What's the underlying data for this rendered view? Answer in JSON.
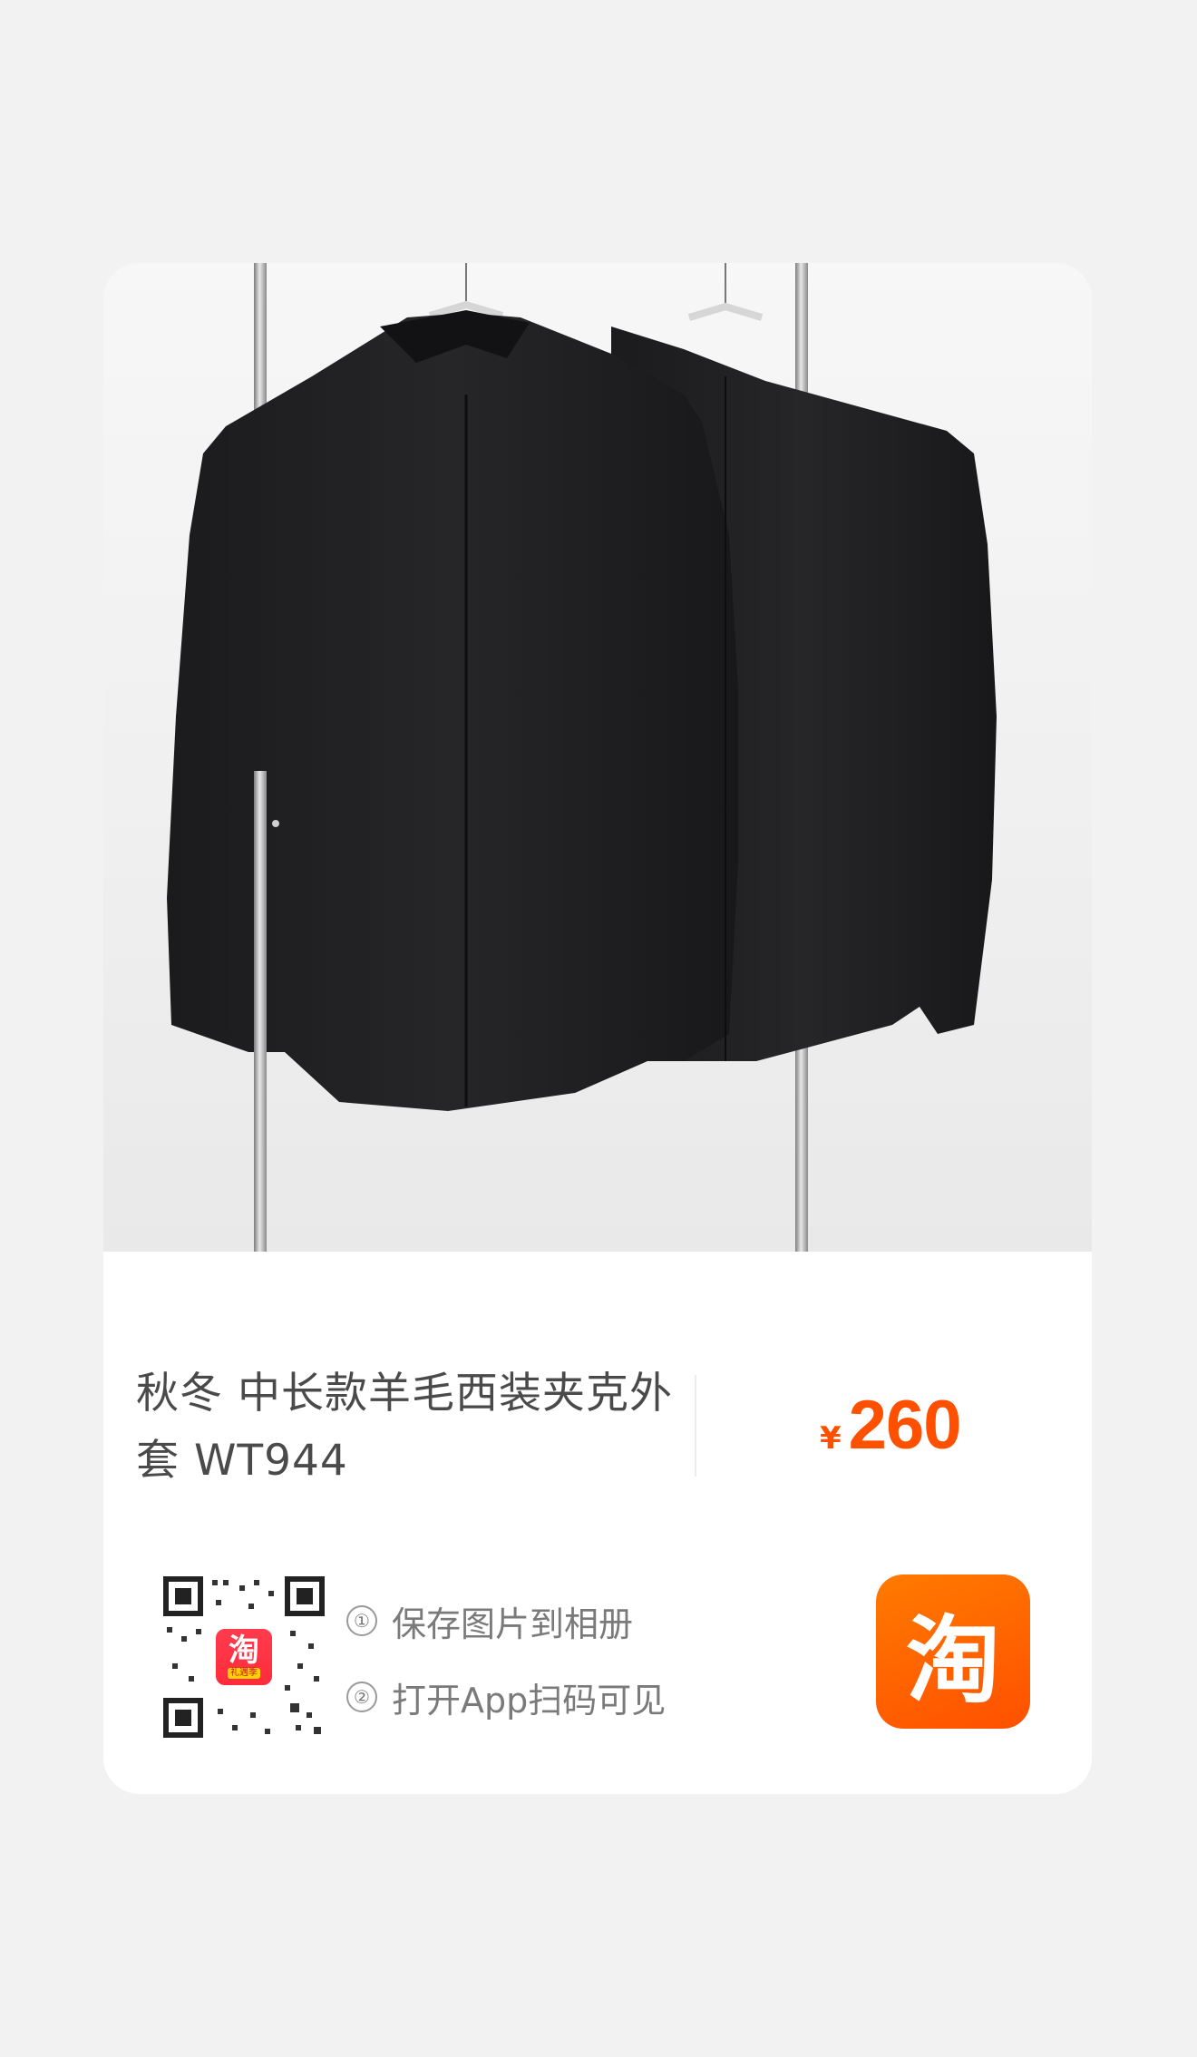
{
  "product": {
    "title": "秋冬 中长款羊毛西装夹克外套 WT944",
    "price_currency": "¥",
    "price_value": "260"
  },
  "share": {
    "step1_num": "①",
    "step1_label": "保存图片到相册",
    "step2_num": "②",
    "step2_label": "打开App扫码可见",
    "qr_badge_glyph": "淘",
    "qr_badge_tag": "礼遇季",
    "app_logo_glyph": "淘"
  },
  "colors": {
    "accent": "#ff5000",
    "page_bg": "#f2f2f2",
    "card_bg": "#ffffff"
  },
  "icons": {
    "app_logo": "taobao-logo-icon",
    "qr": "qr-code-icon"
  }
}
